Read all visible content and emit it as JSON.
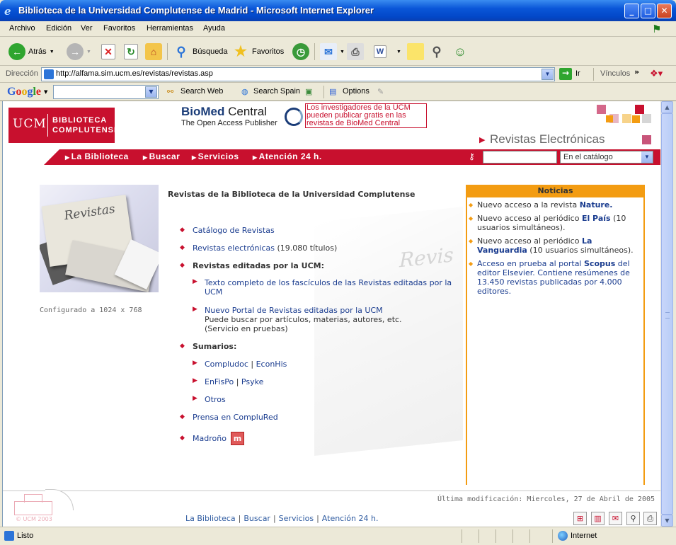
{
  "window": {
    "title": "Biblioteca de la Universidad Complutense de Madrid - Microsoft Internet Explorer",
    "buttons": {
      "minimize": "_",
      "maximize": "□",
      "close": "✕"
    }
  },
  "menu": [
    "Archivo",
    "Edición",
    "Ver",
    "Favoritos",
    "Herramientas",
    "Ayuda"
  ],
  "toolbar": {
    "back": "Atrás",
    "search": "Búsqueda",
    "favorites": "Favoritos"
  },
  "address": {
    "label": "Dirección",
    "url": "http://alfama.sim.ucm.es/revistas/revistas.asp",
    "go": "Ir",
    "links": "Vínculos"
  },
  "google_bar": {
    "logo": "Google",
    "search_web": "Search Web",
    "search_spain": "Search Spain",
    "options": "Options"
  },
  "page": {
    "logo": {
      "ucm": "UCM",
      "line1": "BIBLIOTECA",
      "line2": "COMPLUTENSE"
    },
    "biomed": {
      "name_bold": "BioMed",
      "name_light": "Central",
      "tagline": "The Open Access Publisher"
    },
    "biomed_note": "Los investigadores de la UCM pueden publicar gratis en las revistas de BioMed Central",
    "section_title": "Revistas Electrónicas",
    "nav": [
      "La Biblioteca",
      "Buscar",
      "Servicios",
      "Atención 24 h."
    ],
    "search_select": "En el catálogo",
    "image_label": "Revistas",
    "configured": "Configurado a 1024 x 768",
    "heading": "Revistas de la Biblioteca de la Universidad Complutense",
    "items": {
      "catalogo": "Catálogo de Revistas",
      "electronicas": "Revistas electrónicas",
      "electronicas_count": "(19.080 títulos)",
      "editadas": "Revistas editadas por la UCM:",
      "texto_completo": "Texto completo de los fascículos de las Revistas editadas por la UCM",
      "nuevo_portal": "Nuevo Portal de Revistas editadas por la UCM",
      "nuevo_portal_desc1": "Puede buscar por artículos, materias, autores, etc.",
      "nuevo_portal_desc2": "(Servicio en pruebas)",
      "sumarios": "Sumarios:",
      "compludoc": "Compludoc",
      "econhis": "EconHis",
      "enfispo": "EnFisPo",
      "psyke": "Psyke",
      "otros": "Otros",
      "prensa": "Prensa en CompluRed",
      "madrono": "Madroño"
    },
    "noticias": {
      "title": "Noticias",
      "n1_text": "Nuevo acceso a la revista",
      "n1_bold": "Nature.",
      "n2_text": "Nuevo acceso al periódico",
      "n2_bold": "El País",
      "n2_rest": "(10 usuarios simultáneos).",
      "n3_text": "Nuevo acceso al periódico",
      "n3_bold1": "La",
      "n3_bold2": "Vanguardia",
      "n3_rest": "(10 usuarios simultáneos).",
      "n4_text": "Acceso en prueba al portal",
      "n4_bold": "Scopus",
      "n4_rest": "del editor Elsevier. Contiene resúmenes de 13.450 revistas publicadas por 4.000 editores."
    },
    "last_modified": "Última modificación: Miercoles, 27 de Abril de 2005",
    "footer_logo": "© UCM 2003",
    "footer_nav": [
      "La Biblioteca",
      "Buscar",
      "Servicios",
      "Atención 24 h."
    ]
  },
  "status": {
    "left": "Listo",
    "zone": "Internet"
  },
  "colors": {
    "ucm_red": "#c8102e",
    "noticias_orange": "#f39c12",
    "link_blue": "#1a3c8f"
  }
}
